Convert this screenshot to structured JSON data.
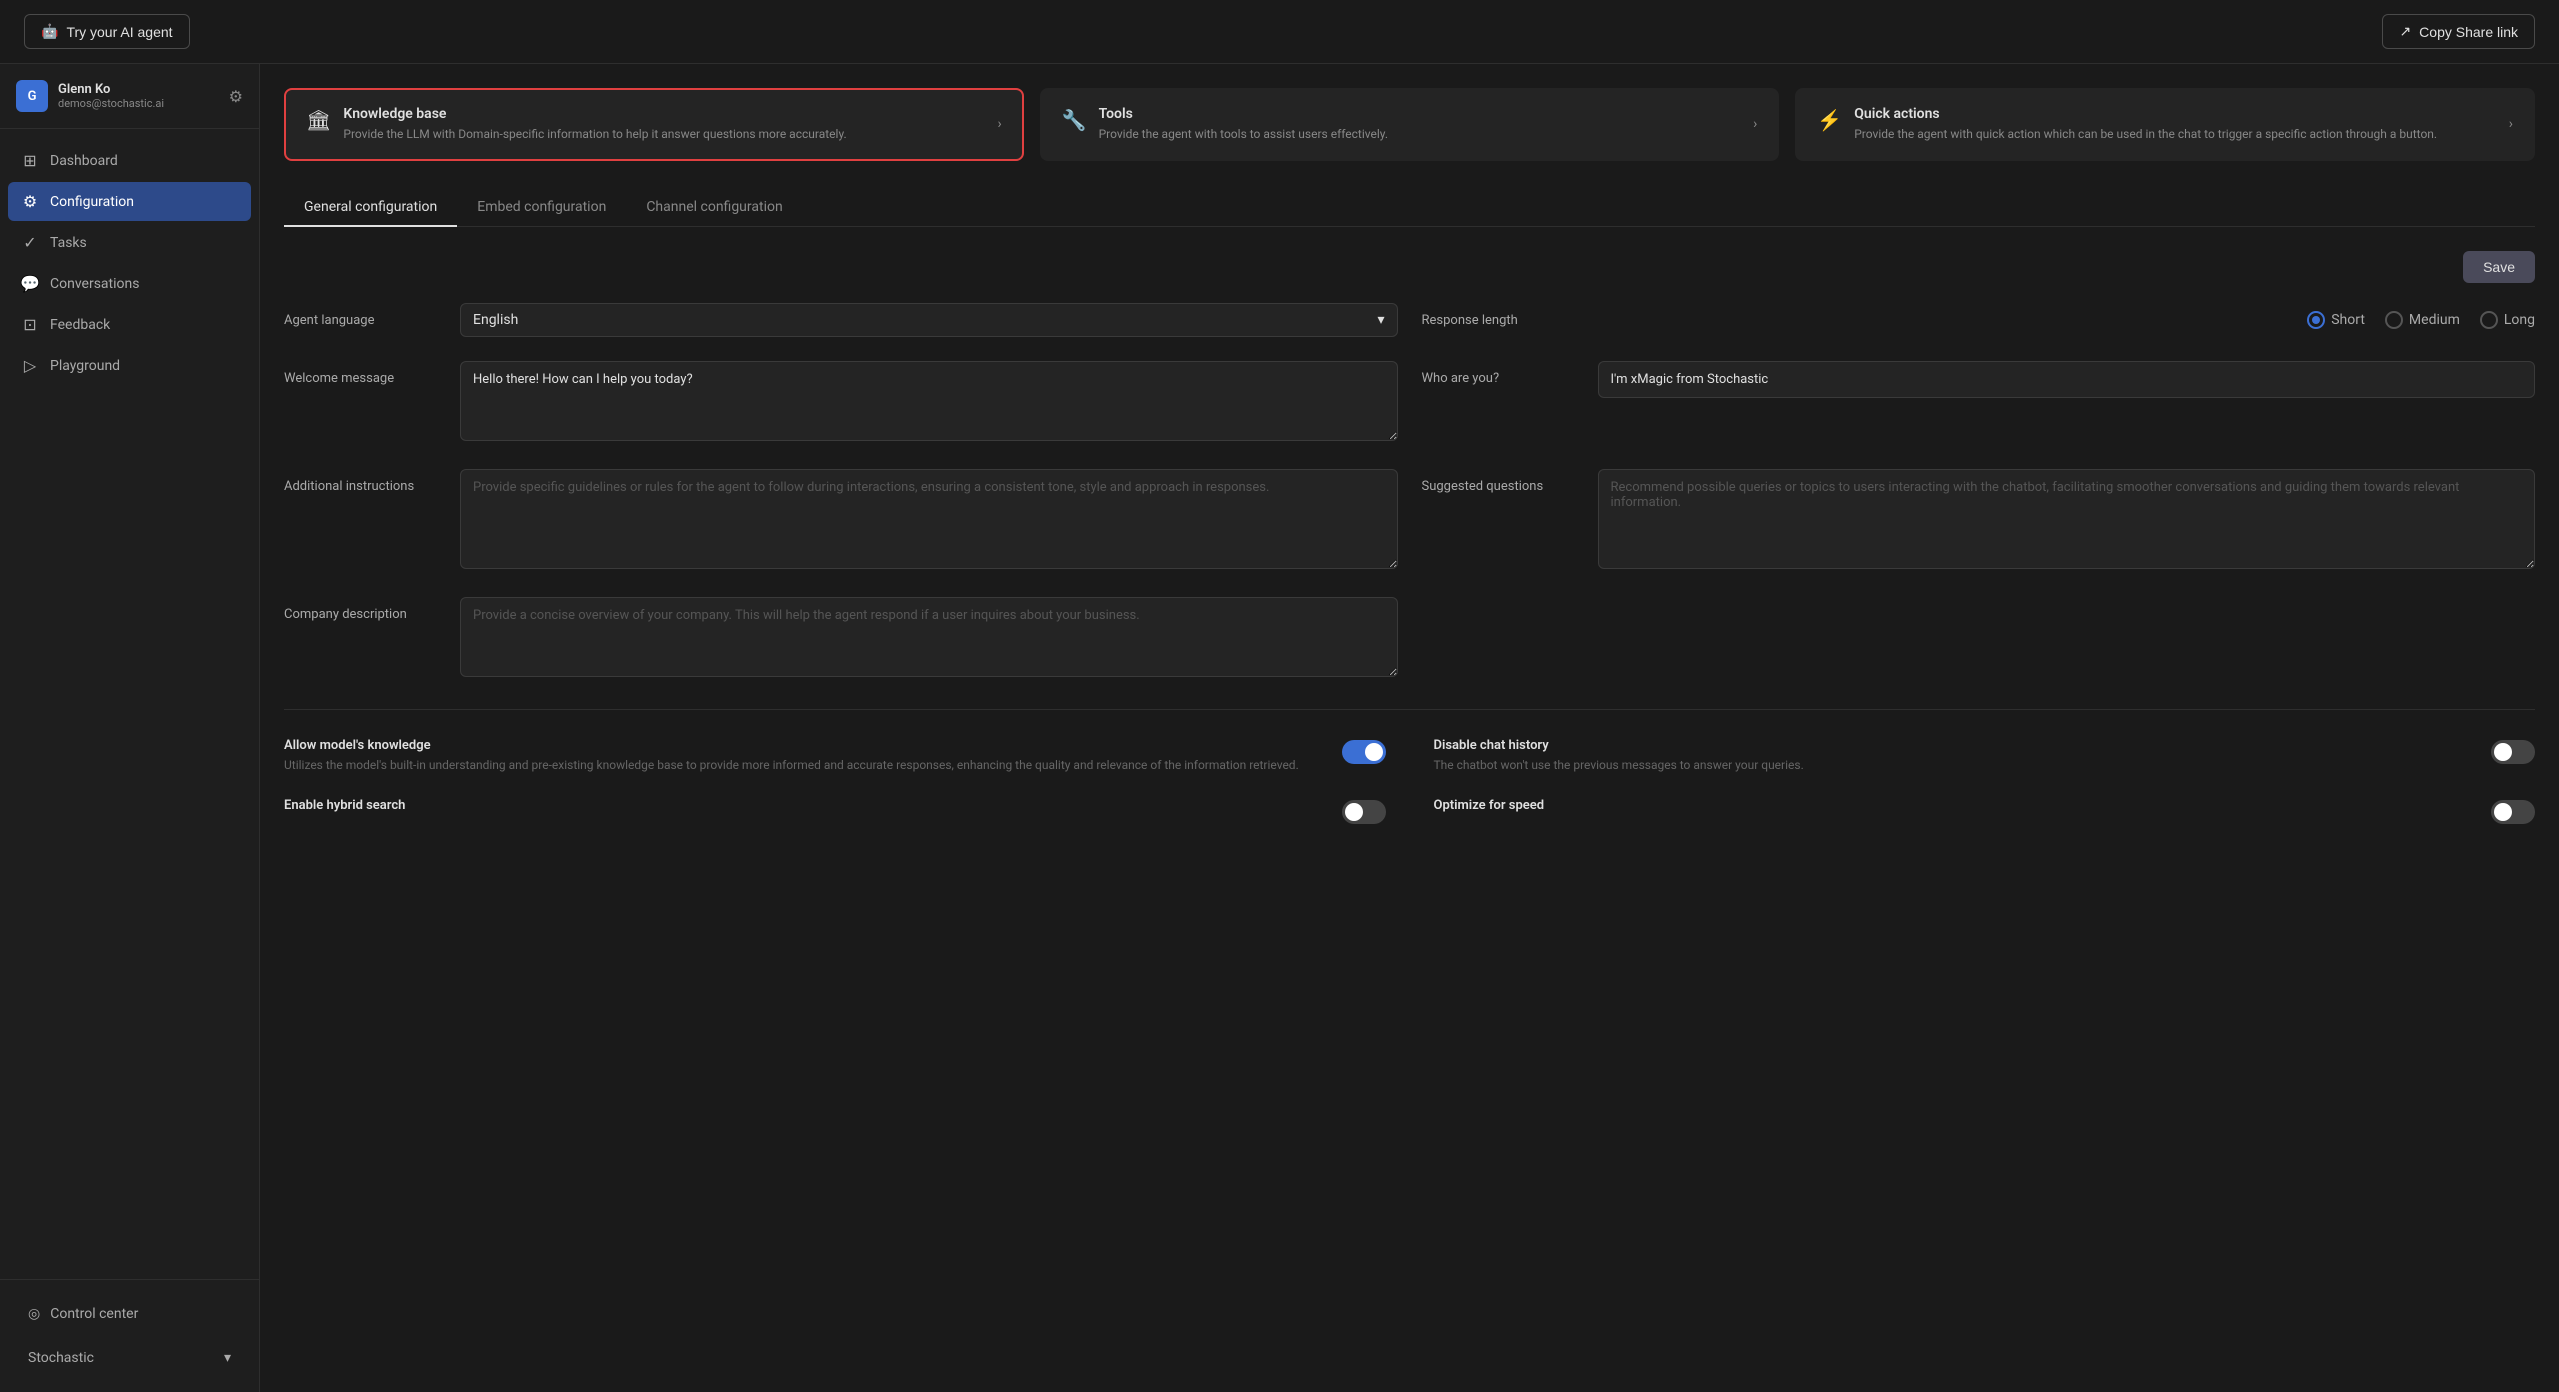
{
  "topbar": {
    "try_agent_label": "Try your AI agent",
    "copy_share_label": "Copy Share link"
  },
  "sidebar": {
    "user": {
      "initials": "G",
      "name": "Glenn Ko",
      "email": "demos@stochastic.ai"
    },
    "nav_items": [
      {
        "id": "dashboard",
        "label": "Dashboard",
        "icon": "⊞",
        "active": false
      },
      {
        "id": "configuration",
        "label": "Configuration",
        "icon": "⚙",
        "active": true
      },
      {
        "id": "tasks",
        "label": "Tasks",
        "icon": "✓",
        "active": false
      },
      {
        "id": "conversations",
        "label": "Conversations",
        "icon": "💬",
        "active": false
      },
      {
        "id": "feedback",
        "label": "Feedback",
        "icon": "⊡",
        "active": false
      },
      {
        "id": "playground",
        "label": "Playground",
        "icon": "▷",
        "active": false
      }
    ],
    "control_center_label": "Control center",
    "workspace_label": "Stochastic"
  },
  "kb_cards": [
    {
      "id": "knowledge-base",
      "icon": "🏛",
      "title": "Knowledge base",
      "description": "Provide the LLM with Domain-specific information to help it answer questions more accurately.",
      "highlighted": true
    },
    {
      "id": "tools",
      "icon": "🔧",
      "title": "Tools",
      "description": "Provide the agent with tools to assist users effectively.",
      "highlighted": false
    },
    {
      "id": "quick-actions",
      "icon": "⚡",
      "title": "Quick actions",
      "description": "Provide the agent with quick action which can be used in the chat to trigger a specific action through a button.",
      "highlighted": false
    }
  ],
  "tabs": [
    {
      "id": "general",
      "label": "General configuration",
      "active": true
    },
    {
      "id": "embed",
      "label": "Embed configuration",
      "active": false
    },
    {
      "id": "channel",
      "label": "Channel configuration",
      "active": false
    }
  ],
  "save_label": "Save",
  "general_config": {
    "agent_language_label": "Agent language",
    "agent_language_value": "English",
    "response_length_label": "Response length",
    "response_options": [
      {
        "id": "short",
        "label": "Short",
        "selected": true
      },
      {
        "id": "medium",
        "label": "Medium",
        "selected": false
      },
      {
        "id": "long",
        "label": "Long",
        "selected": false
      }
    ],
    "welcome_message_label": "Welcome message",
    "welcome_message_value": "Hello there! How can I help you today?",
    "who_are_you_label": "Who are you?",
    "who_are_you_value": "I'm xMagic from Stochastic",
    "additional_instructions_label": "Additional instructions",
    "additional_instructions_placeholder": "Provide specific guidelines or rules for the agent to follow during interactions, ensuring a consistent tone, style and approach in responses.",
    "suggested_questions_label": "Suggested questions",
    "suggested_questions_placeholder": "Recommend possible queries or topics to users interacting with the chatbot, facilitating smoother conversations and guiding them towards relevant information.",
    "company_description_label": "Company description",
    "company_description_placeholder": "Provide a concise overview of your company. This will help the agent respond if a user inquires about your business."
  },
  "toggles": [
    {
      "id": "allow-model-knowledge",
      "title": "Allow model's knowledge",
      "description": "Utilizes the model's built-in understanding and pre-existing knowledge base to provide more informed and accurate responses, enhancing the quality and relevance of the information retrieved.",
      "on": true
    },
    {
      "id": "disable-chat-history",
      "title": "Disable chat history",
      "description": "The chatbot won't use the previous messages to answer your queries.",
      "on": false
    },
    {
      "id": "enable-hybrid-search",
      "title": "Enable hybrid search",
      "description": "",
      "on": false
    },
    {
      "id": "optimize-for-speed",
      "title": "Optimize for speed",
      "description": "",
      "on": false
    }
  ]
}
